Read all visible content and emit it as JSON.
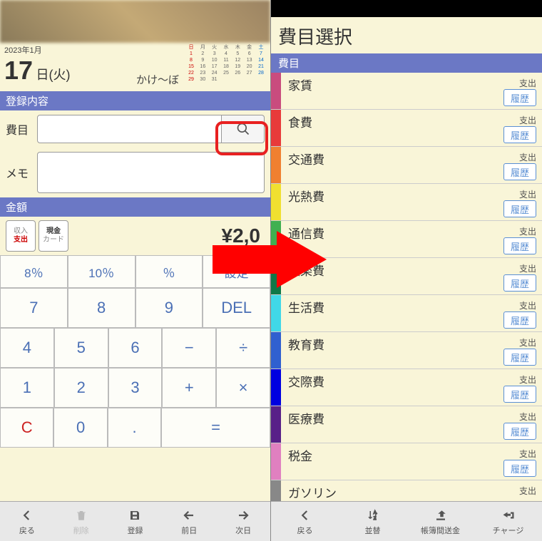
{
  "left": {
    "date_year": "2023年1月",
    "date_day": "17",
    "date_suffix": "日(火)",
    "app_name": "かけ〜ぼ",
    "calendar_days_header": [
      "日",
      "月",
      "火",
      "水",
      "木",
      "金",
      "土"
    ],
    "calendar_rows": [
      [
        "1",
        "2",
        "3",
        "4",
        "5",
        "6",
        "7"
      ],
      [
        "8",
        "9",
        "10",
        "11",
        "12",
        "13",
        "14"
      ],
      [
        "15",
        "16",
        "17",
        "18",
        "19",
        "20",
        "21"
      ],
      [
        "22",
        "23",
        "24",
        "25",
        "26",
        "27",
        "28"
      ],
      [
        "29",
        "30",
        "31",
        "",
        "",
        "",
        ""
      ]
    ],
    "section_register": "登録内容",
    "label_category": "費目",
    "label_memo": "メモ",
    "section_amount": "金額",
    "btn_income": "収入",
    "btn_expense": "支出",
    "btn_cash": "現金",
    "btn_card": "カード",
    "amount_value": "¥2,0",
    "keypad": {
      "r1": [
        "8％",
        "10％",
        "％",
        "設定"
      ],
      "r2": [
        "7",
        "8",
        "9",
        "DEL"
      ],
      "r3": [
        "4",
        "5",
        "6",
        "−",
        "÷"
      ],
      "r4": [
        "1",
        "2",
        "3",
        "+",
        "×"
      ],
      "r5_c": "C",
      "r5_0": "0",
      "r5_dot": ".",
      "r5_eq": "="
    },
    "nav": {
      "back": "戻る",
      "delete": "削除",
      "register": "登録",
      "prev": "前日",
      "next": "次日"
    }
  },
  "right": {
    "title": "費目選択",
    "list_header": "費目",
    "type_expense": "支出",
    "history_label": "履歴",
    "categories": [
      {
        "name": "家賃",
        "color": "#c94c7e"
      },
      {
        "name": "食費",
        "color": "#e83a3a"
      },
      {
        "name": "交通費",
        "color": "#f08030"
      },
      {
        "name": "光熱費",
        "color": "#f0e030"
      },
      {
        "name": "通信費",
        "color": "#40b050"
      },
      {
        "name": "娯楽費",
        "color": "#107848"
      },
      {
        "name": "生活費",
        "color": "#40d8e8"
      },
      {
        "name": "教育費",
        "color": "#3060d0"
      },
      {
        "name": "交際費",
        "color": "#0000e0"
      },
      {
        "name": "医療費",
        "color": "#582088"
      },
      {
        "name": "税金",
        "color": "#e080c0"
      },
      {
        "name": "ガソリン",
        "color": "#888888"
      }
    ],
    "nav": {
      "back": "戻る",
      "sort": "並替",
      "transfer": "帳簿間送金",
      "charge": "チャージ"
    }
  }
}
